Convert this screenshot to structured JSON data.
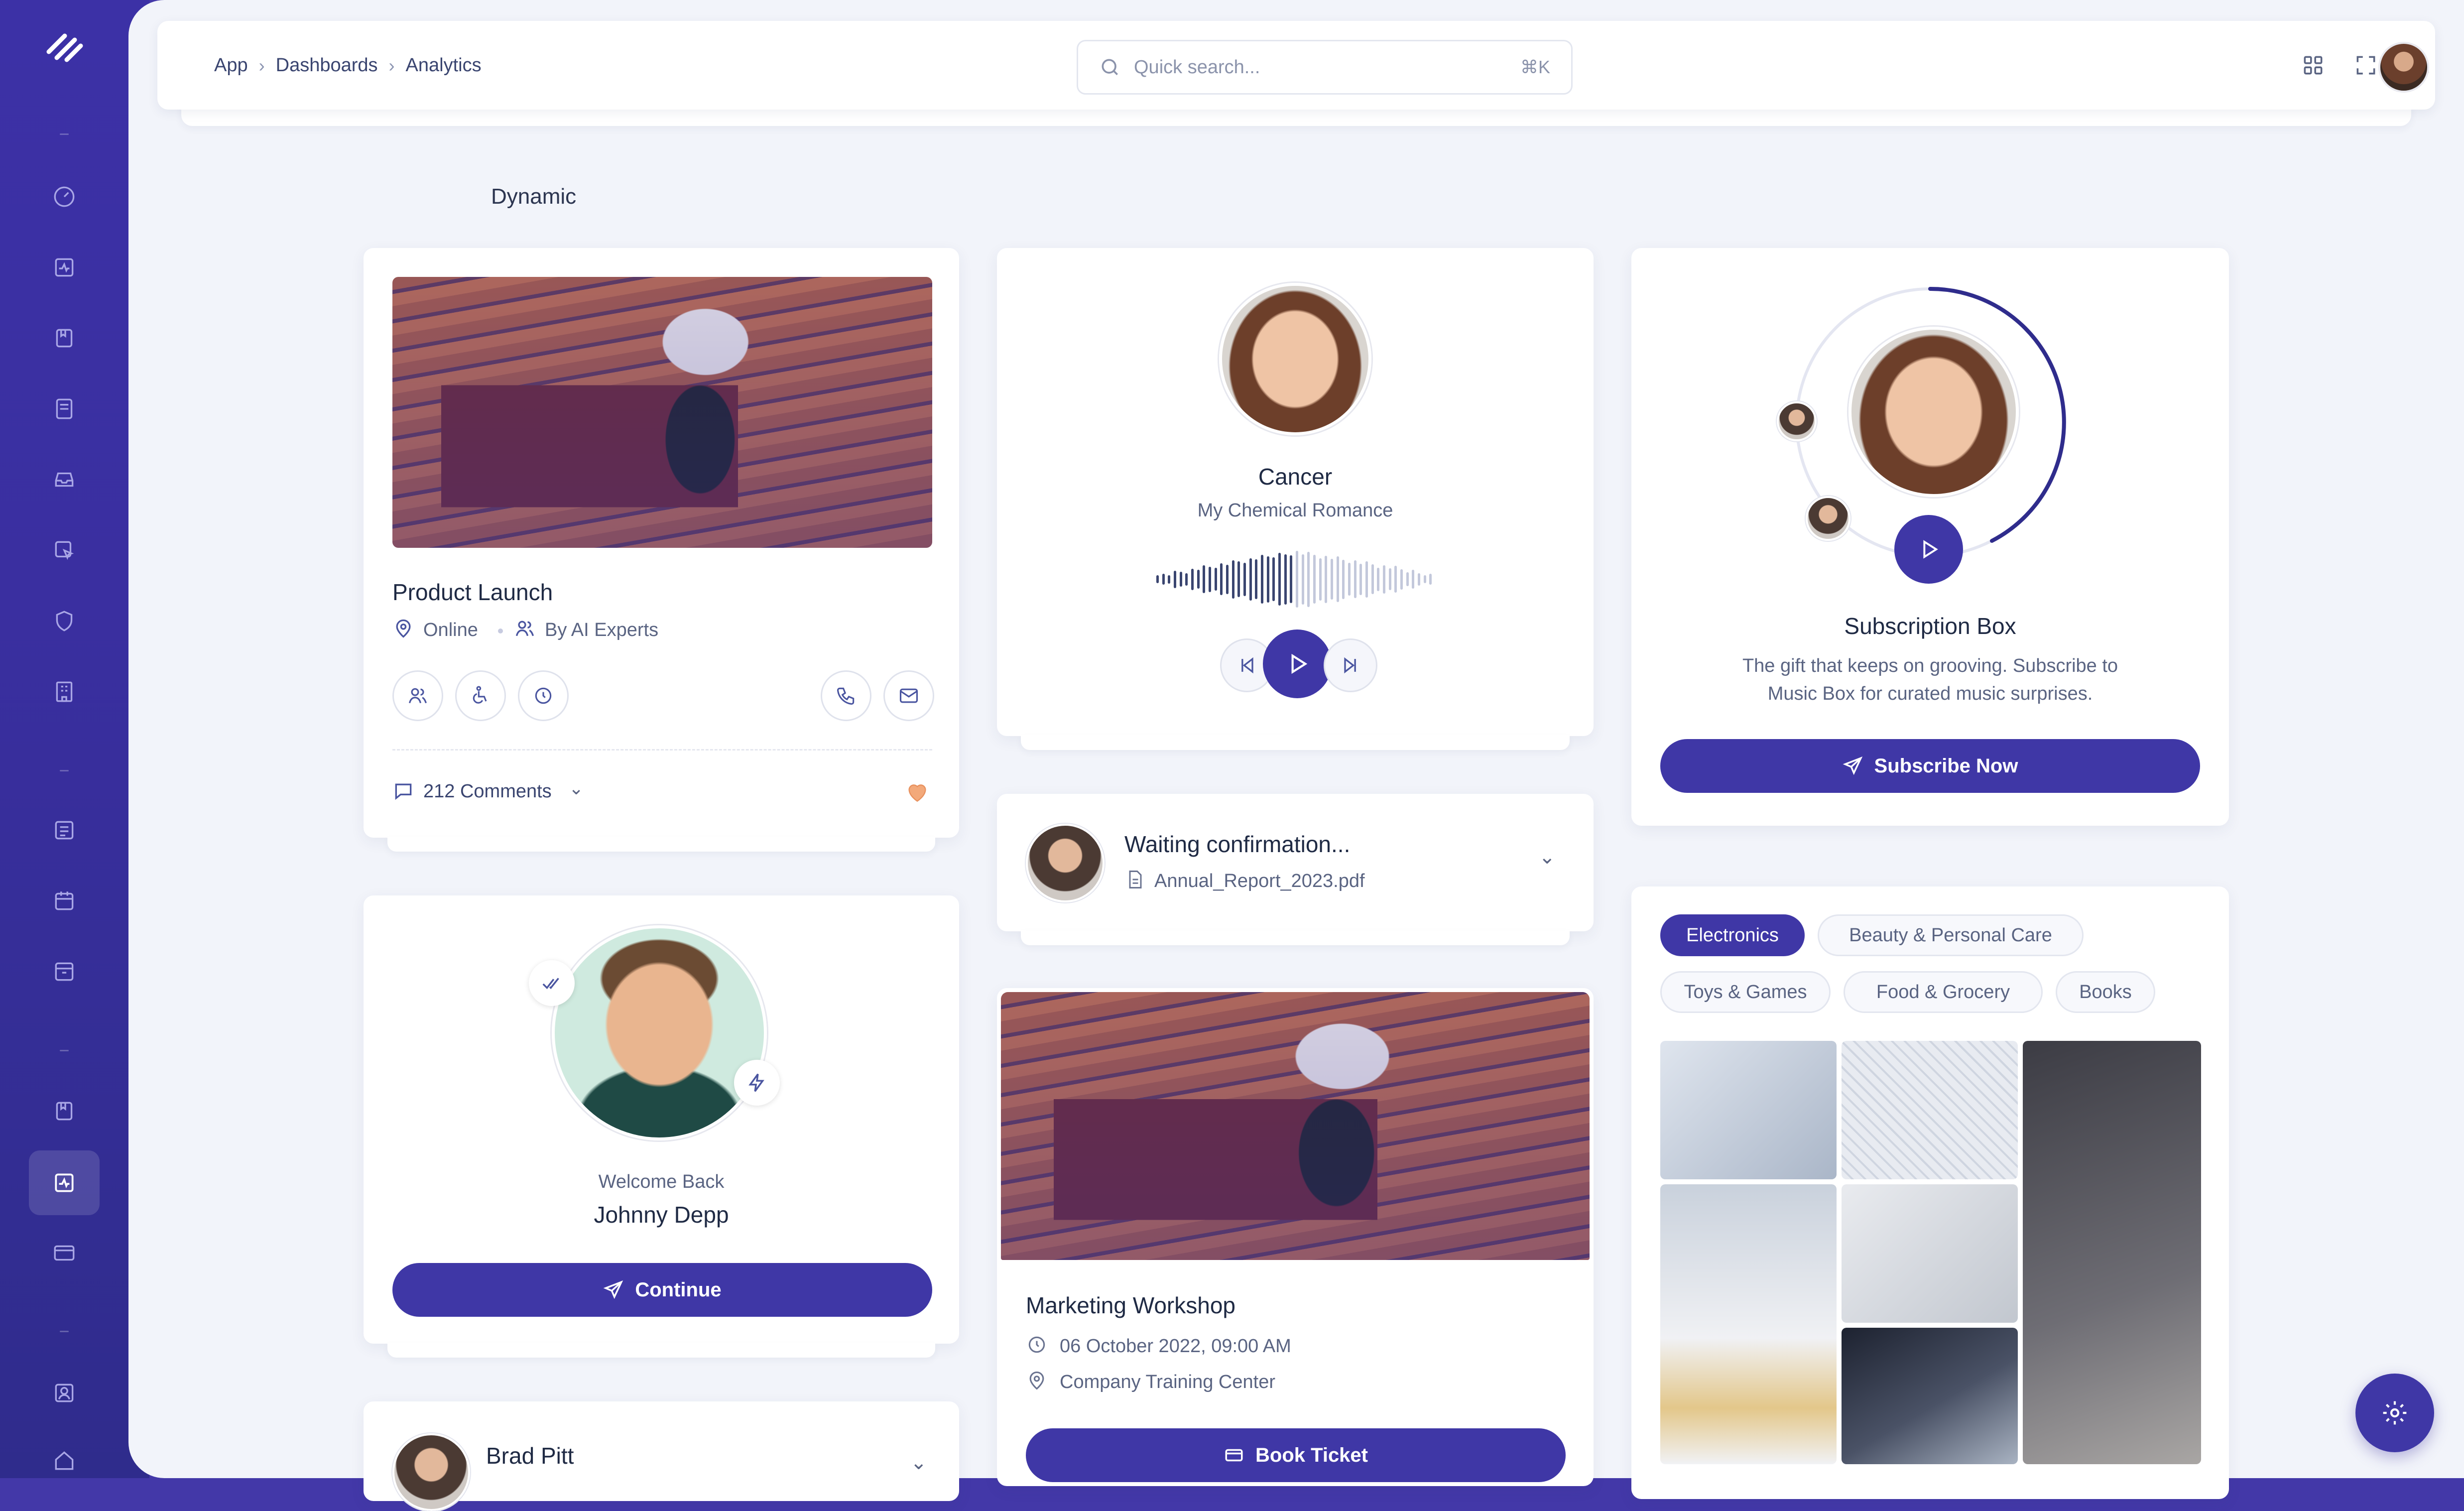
{
  "breadcrumb": {
    "items": [
      "App",
      "Dashboards",
      "Analytics"
    ]
  },
  "search": {
    "placeholder": "Quick search...",
    "shortcut": "⌘K"
  },
  "section": {
    "title": "Dynamic"
  },
  "product_launch": {
    "title": "Product Launch",
    "location": "Online",
    "author": "By AI Experts",
    "comments": "212 Comments"
  },
  "player": {
    "song": "Cancer",
    "artist": "My Chemical Romance"
  },
  "subscription": {
    "title": "Subscription Box",
    "description_line1": "The gift that keeps on grooving. Subscribe to",
    "description_line2": "Music Box for curated music surprises.",
    "button": "Subscribe Now"
  },
  "confirmation": {
    "title": "Waiting confirmation...",
    "file": "Annual_Report_2023.pdf"
  },
  "welcome": {
    "greeting": "Welcome Back",
    "name": "Johnny Depp",
    "button": "Continue"
  },
  "workshop": {
    "title": "Marketing Workshop",
    "datetime": "06 October 2022, 09:00 AM",
    "location": "Company Training Center",
    "button": "Book Ticket"
  },
  "contact": {
    "name": "Brad Pitt"
  },
  "categories": {
    "items": [
      "Electronics",
      "Beauty & Personal Care",
      "Toys & Games",
      "Food & Grocery",
      "Books"
    ],
    "active": "Electronics"
  },
  "colors": {
    "accent": "#3f37a6",
    "sidebar": "#3a2fa0",
    "like": "#f0a070"
  }
}
